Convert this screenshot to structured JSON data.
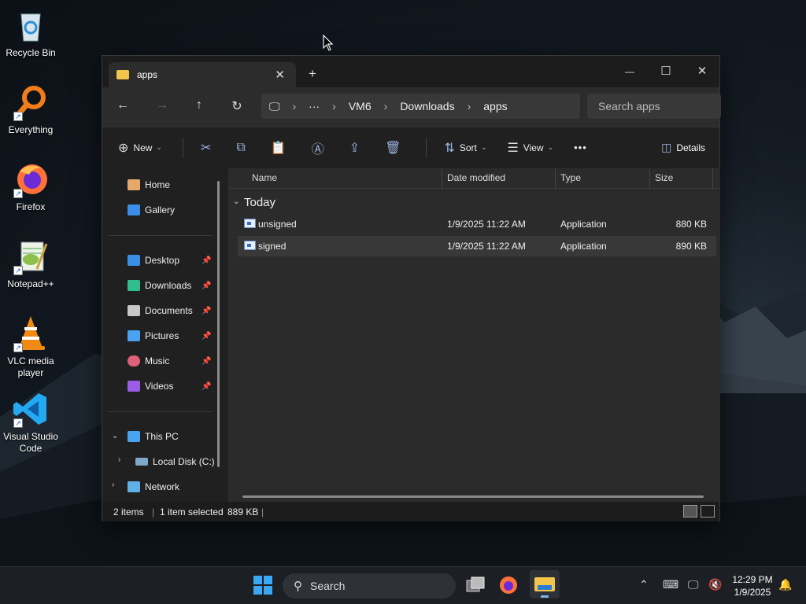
{
  "desktop": {
    "icons": [
      {
        "label": "Recycle Bin"
      },
      {
        "label": "Everything"
      },
      {
        "label": "Firefox"
      },
      {
        "label": "Notepad++"
      },
      {
        "label": "VLC media player"
      },
      {
        "label": "Visual Studio Code"
      }
    ]
  },
  "window": {
    "tab_title": "apps",
    "close_tab": "✕",
    "new_tab": "+",
    "controls": {
      "minimize": "—",
      "maximize": "☐",
      "close": "✕"
    },
    "address": {
      "segments": [
        "VM6",
        "Downloads",
        "apps"
      ],
      "ellipsis": "···"
    },
    "search_placeholder": "Search apps",
    "toolbar": {
      "new_label": "New",
      "sort_label": "Sort",
      "view_label": "View",
      "more_label": "•••",
      "details_label": "Details"
    },
    "sidebar": {
      "home": "Home",
      "gallery": "Gallery",
      "quick": [
        {
          "label": "Desktop",
          "color": "#3a8ee6"
        },
        {
          "label": "Downloads",
          "color": "#2fbf8f"
        },
        {
          "label": "Documents",
          "color": "#c8c8c8"
        },
        {
          "label": "Pictures",
          "color": "#4aa3f0"
        },
        {
          "label": "Music",
          "color": "#e0607a"
        },
        {
          "label": "Videos",
          "color": "#9b5de5"
        }
      ],
      "this_pc": "This PC",
      "local_disk": "Local Disk (C:)",
      "network": "Network"
    },
    "columns": {
      "name": "Name",
      "date": "Date modified",
      "type": "Type",
      "size": "Size"
    },
    "group": "Today",
    "files": [
      {
        "name": "unsigned",
        "date": "1/9/2025 11:22 AM",
        "type": "Application",
        "size": "880 KB"
      },
      {
        "name": "signed",
        "date": "1/9/2025 11:22 AM",
        "type": "Application",
        "size": "890 KB"
      }
    ],
    "status": {
      "count": "2 items",
      "selected": "1 item selected",
      "size": "889 KB"
    }
  },
  "taskbar": {
    "search_label": "Search",
    "time": "12:29 PM",
    "date": "1/9/2025"
  }
}
